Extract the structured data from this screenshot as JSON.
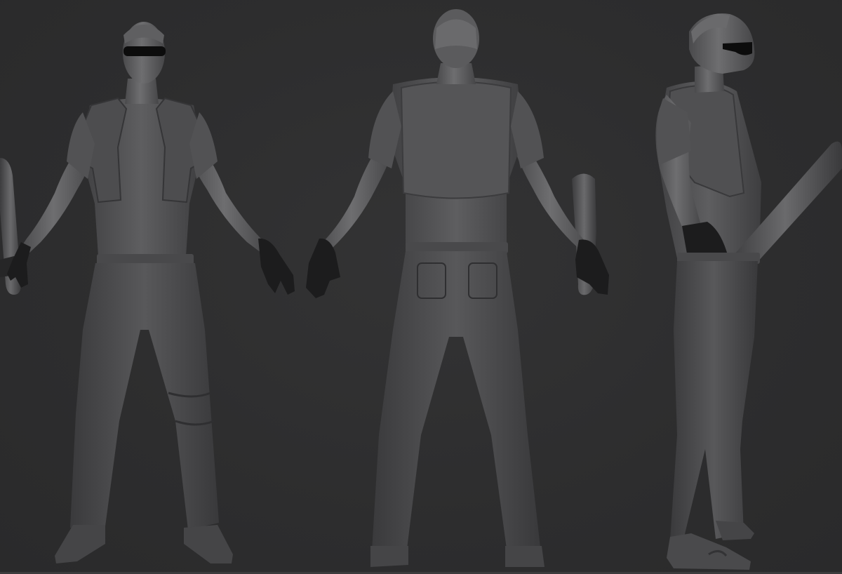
{
  "scene": {
    "background_color": "#2e2e2f",
    "model_color": "#5a5a5c",
    "model_shadow_color": "#3a3a3b",
    "model_highlight_color": "#808082",
    "glove_color": "#1c1c1d",
    "glasses_color": "#0c0c0c",
    "views": [
      {
        "name": "front-view",
        "holds_bat": true
      },
      {
        "name": "back-view",
        "holds_bat": true
      },
      {
        "name": "side-view",
        "holds_bat": true
      }
    ]
  }
}
